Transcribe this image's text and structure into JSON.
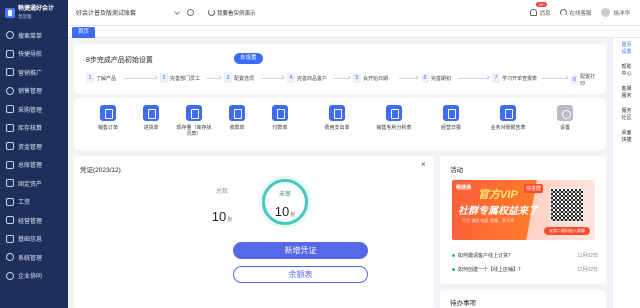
{
  "brand": {
    "name": "畅捷通好会计",
    "sub": "普及版"
  },
  "sidebar": {
    "items": [
      {
        "label": "搜索菜单",
        "icon": "search-icon"
      },
      {
        "label": "快捷导航",
        "icon": "rocket-icon"
      },
      {
        "label": "营销推广",
        "icon": "megaphone-icon"
      },
      {
        "label": "销售管理",
        "icon": "sales-icon"
      },
      {
        "label": "采购管理",
        "icon": "cart-icon"
      },
      {
        "label": "库存核算",
        "icon": "box-icon"
      },
      {
        "label": "资金管理",
        "icon": "wallet-icon"
      },
      {
        "label": "总账管理",
        "icon": "ledger-icon"
      },
      {
        "label": "固定资产",
        "icon": "asset-icon"
      },
      {
        "label": "工资",
        "icon": "salary-icon"
      },
      {
        "label": "经营管理",
        "icon": "chart-icon"
      },
      {
        "label": "基础信息",
        "icon": "info-icon"
      },
      {
        "label": "系统管理",
        "icon": "gear-icon"
      },
      {
        "label": "企业协同",
        "icon": "team-icon"
      }
    ]
  },
  "topbar": {
    "account": "好会计普及版测试账套",
    "demo_label": "我要看实例演示",
    "messages_label": "消息",
    "messages_badge": "99+",
    "service_label": "在线客服",
    "user_name": "徐洋华"
  },
  "tabs": [
    {
      "label": "首页"
    }
  ],
  "right_rail": [
    {
      "label": "首页\n设置",
      "active": true
    },
    {
      "label": "帮助\n中心",
      "active": false
    },
    {
      "label": "客服\n服务",
      "active": false
    },
    {
      "label": "服务\n社区",
      "active": false
    },
    {
      "label": "桌面\n快捷",
      "active": false
    }
  ],
  "setup": {
    "title": "8步完成产品初始设置",
    "button": "去设置",
    "steps": [
      {
        "num": "1",
        "label": "了解产品"
      },
      {
        "num": "2",
        "label": "完善部门员工"
      },
      {
        "num": "3",
        "label": "配置选项"
      },
      {
        "num": "4",
        "label": "完善商品客户"
      },
      {
        "num": "5",
        "label": "会开始日期"
      },
      {
        "num": "6",
        "label": "完善期初"
      },
      {
        "num": "7",
        "label": "学习开单查报表"
      },
      {
        "num": "8",
        "label": "配置打印"
      }
    ]
  },
  "quick_actions": [
    {
      "label": "销售订单",
      "icon": "sales-order-icon"
    },
    {
      "label": "进货单",
      "icon": "purchase-icon"
    },
    {
      "label": "现存量（库存状况表）",
      "icon": "inventory-icon"
    },
    {
      "label": "收款单",
      "icon": "receipt-icon"
    },
    {
      "label": "付款单",
      "icon": "payment-icon"
    },
    {
      "label": "费用支出单",
      "icon": "expense-icon"
    },
    {
      "label": "销售毛利分析表",
      "icon": "profit-report-icon"
    },
    {
      "label": "经营日报",
      "icon": "daily-report-icon"
    },
    {
      "label": "业务对账报告表",
      "icon": "reconcile-icon"
    },
    {
      "label": "设置",
      "icon": "settings-icon"
    }
  ],
  "voucher": {
    "title": "凭证(2023/12)",
    "total_label": "总数",
    "total_value": "10",
    "unit": "张",
    "unreviewed_label": "未审",
    "unreviewed_value": "10",
    "primary_button": "新增凭证",
    "secondary_button": "余额表"
  },
  "activity": {
    "title": "活动",
    "banner": {
      "brand": "畅捷通",
      "headline": "官方VIP",
      "tag": "快进群",
      "line2": "社群专属权益来了",
      "sub": "干货·课程·抽奖·客服，享不停",
      "scan": "长按二维码加入群聊"
    },
    "news": [
      {
        "title": "如何邀请客户线上订货？",
        "date": "11月02日"
      },
      {
        "title": "如何创建一个【线上店铺】？",
        "date": "11月02日"
      }
    ]
  },
  "todo": {
    "title": "待办事项"
  }
}
